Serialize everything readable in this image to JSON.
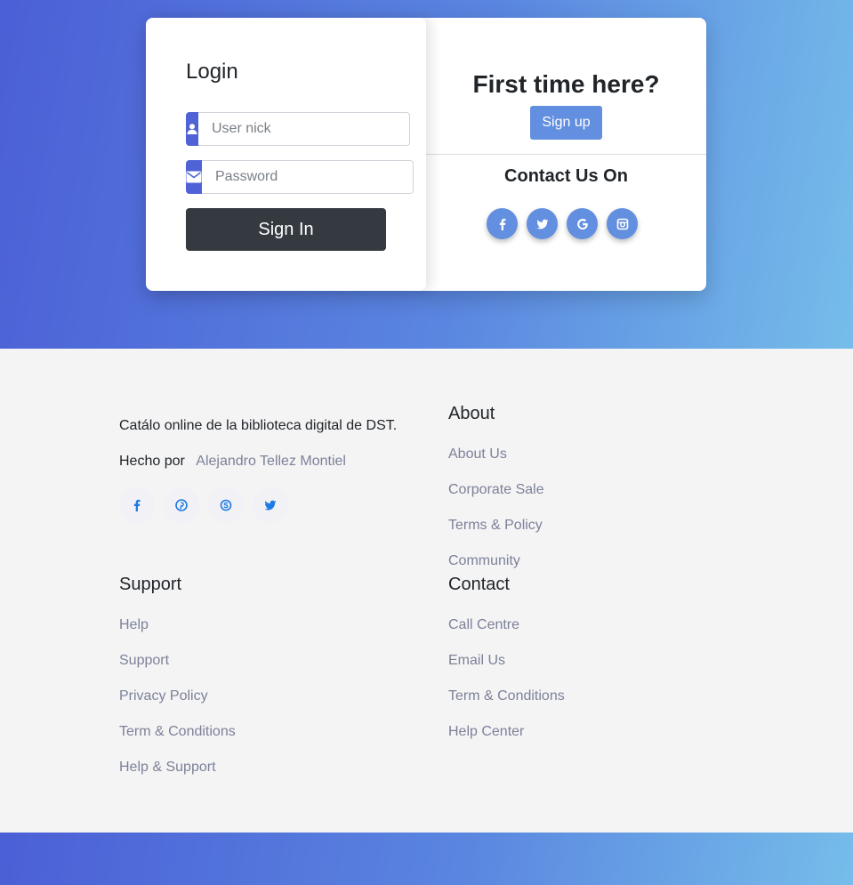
{
  "login": {
    "title": "Login",
    "user_placeholder": "User nick",
    "password_placeholder": "Password",
    "signin_label": "Sign In"
  },
  "signup": {
    "title": "First time here?",
    "button_label": "Sign up",
    "contact_title": "Contact Us On",
    "social_icons": [
      "facebook-icon",
      "twitter-icon",
      "google-icon",
      "instagram-icon"
    ]
  },
  "footer": {
    "description": "Catálo online de la biblioteca digital de DST.",
    "made_by_label": "Hecho por",
    "made_by_author": "Alejandro Tellez Montiel",
    "social_icons": [
      "facebook-icon",
      "pinterest-icon",
      "skype-icon",
      "twitter-icon"
    ],
    "about": {
      "title": "About",
      "links": [
        "About Us",
        "Corporate Sale",
        "Terms & Policy",
        "Community"
      ]
    },
    "support": {
      "title": "Support",
      "links": [
        "Help",
        "Support",
        "Privacy Policy",
        "Term & Conditions",
        "Help & Support"
      ]
    },
    "contact": {
      "title": "Contact",
      "links": [
        "Call Centre",
        "Email Us",
        "Term & Conditions",
        "Help Center"
      ]
    }
  },
  "colors": {
    "gradient_start": "#4b5fd6",
    "gradient_end": "#75bdea",
    "input_icon_bg": "#4f63d6",
    "signin_bg": "#343a40",
    "accent_blue": "#628fdf",
    "footer_link": "#7d8198",
    "footer_social_icon": "#1e7be3"
  }
}
